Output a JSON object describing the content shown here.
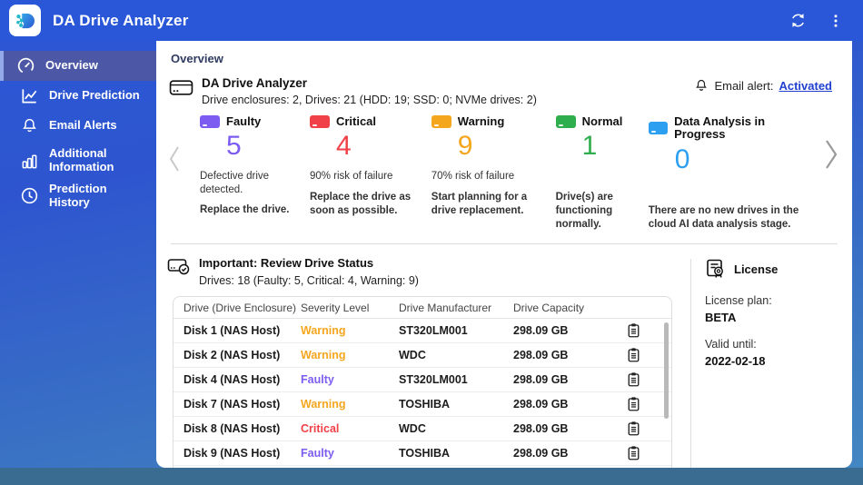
{
  "app": {
    "title": "DA Drive Analyzer"
  },
  "header": {
    "actions": [
      {
        "icon": "refresh-icon"
      },
      {
        "icon": "more-menu-icon"
      }
    ]
  },
  "sidebar": {
    "items": [
      {
        "label": "Overview",
        "icon": "gauge-icon",
        "active": true
      },
      {
        "label": "Drive Prediction",
        "icon": "trend-chart-icon",
        "active": false
      },
      {
        "label": "Email Alerts",
        "icon": "bell-icon",
        "active": false
      },
      {
        "label": "Additional Information",
        "icon": "bar-chart-icon",
        "active": false
      },
      {
        "label": "Prediction History",
        "icon": "clock-icon",
        "active": false
      }
    ]
  },
  "overview": {
    "page_title": "Overview",
    "product_title": "DA Drive Analyzer",
    "drive_summary": "Drive enclosures: 2, Drives: 21 (HDD: 19; SSD: 0; NVMe drives: 2)",
    "email_alert_label": "Email alert:",
    "email_alert_link": "Activated"
  },
  "status_cards": {
    "items": [
      {
        "label": "Faulty",
        "count": "5",
        "color": "#7d5cf2",
        "desc1": "Defective drive detected.",
        "desc2": "Replace the drive."
      },
      {
        "label": "Critical",
        "count": "4",
        "color": "#ef4147",
        "desc1": "90% risk of failure",
        "desc2": "Replace the drive as soon as possible."
      },
      {
        "label": "Warning",
        "count": "9",
        "color": "#f5a61f",
        "desc1": "70% risk of failure",
        "desc2": "Start planning for a drive replacement."
      },
      {
        "label": "Normal",
        "count": "1",
        "color": "#2fae4e",
        "desc1": "",
        "desc2": "Drive(s) are functioning normally."
      },
      {
        "label": "Data Analysis in Progress",
        "count": "0",
        "color": "#2d9ff0",
        "desc1": "",
        "desc2": "There are no new drives in the cloud AI data  analysis  stage."
      }
    ]
  },
  "drive_status": {
    "title": "Important: Review Drive Status",
    "subtitle": "Drives: 18 (Faulty: 5, Critical: 4, Warning: 9)",
    "columns": [
      "Drive (Drive Enclosure)",
      "Severity Level",
      "Drive Manufacturer",
      "Drive Capacity"
    ],
    "rows": [
      {
        "drive": "Disk 1 (NAS Host)",
        "severity": "Warning",
        "severity_color": "#f5a61f",
        "manufacturer": "ST320LM001",
        "capacity": "298.09 GB"
      },
      {
        "drive": "Disk 2 (NAS Host)",
        "severity": "Warning",
        "severity_color": "#f5a61f",
        "manufacturer": "WDC",
        "capacity": "298.09 GB"
      },
      {
        "drive": "Disk 4 (NAS Host)",
        "severity": "Faulty",
        "severity_color": "#7d5cf2",
        "manufacturer": "ST320LM001",
        "capacity": "298.09 GB"
      },
      {
        "drive": "Disk 7 (NAS Host)",
        "severity": "Warning",
        "severity_color": "#f5a61f",
        "manufacturer": "TOSHIBA",
        "capacity": "298.09 GB"
      },
      {
        "drive": "Disk 8 (NAS Host)",
        "severity": "Critical",
        "severity_color": "#ef4147",
        "manufacturer": "WDC",
        "capacity": "298.09 GB"
      },
      {
        "drive": "Disk 9 (NAS Host)",
        "severity": "Faulty",
        "severity_color": "#7d5cf2",
        "manufacturer": "TOSHIBA",
        "capacity": "298.09 GB"
      },
      {
        "drive": "",
        "severity": "",
        "severity_color": "",
        "manufacturer": "",
        "capacity": ""
      }
    ]
  },
  "license": {
    "title": "License",
    "plan_label": "License plan:",
    "plan_value": "BETA",
    "valid_label": "Valid until:",
    "valid_value": "2022-02-18"
  }
}
